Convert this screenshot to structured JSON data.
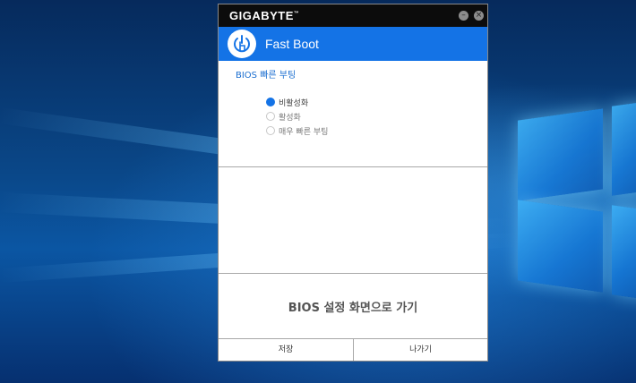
{
  "window": {
    "brand": "GIGABYTE",
    "brand_mark": "™",
    "minimize_glyph": "–",
    "close_glyph": "×"
  },
  "header": {
    "title": "Fast Boot",
    "icon": "power-touch-icon"
  },
  "section": {
    "title": "BIOS 빠른 부팅"
  },
  "options": [
    {
      "label": "비활성화",
      "selected": true
    },
    {
      "label": "활성화",
      "selected": false
    },
    {
      "label": "매우 빠른 부팅",
      "selected": false
    }
  ],
  "bios_link": "BIOS 설정 화면으로 가기",
  "footer": {
    "save_label": "저장",
    "exit_label": "나가기"
  },
  "colors": {
    "accent": "#1473e6",
    "titlebar": "#0c0c0c",
    "section_title": "#1c6fd0"
  }
}
